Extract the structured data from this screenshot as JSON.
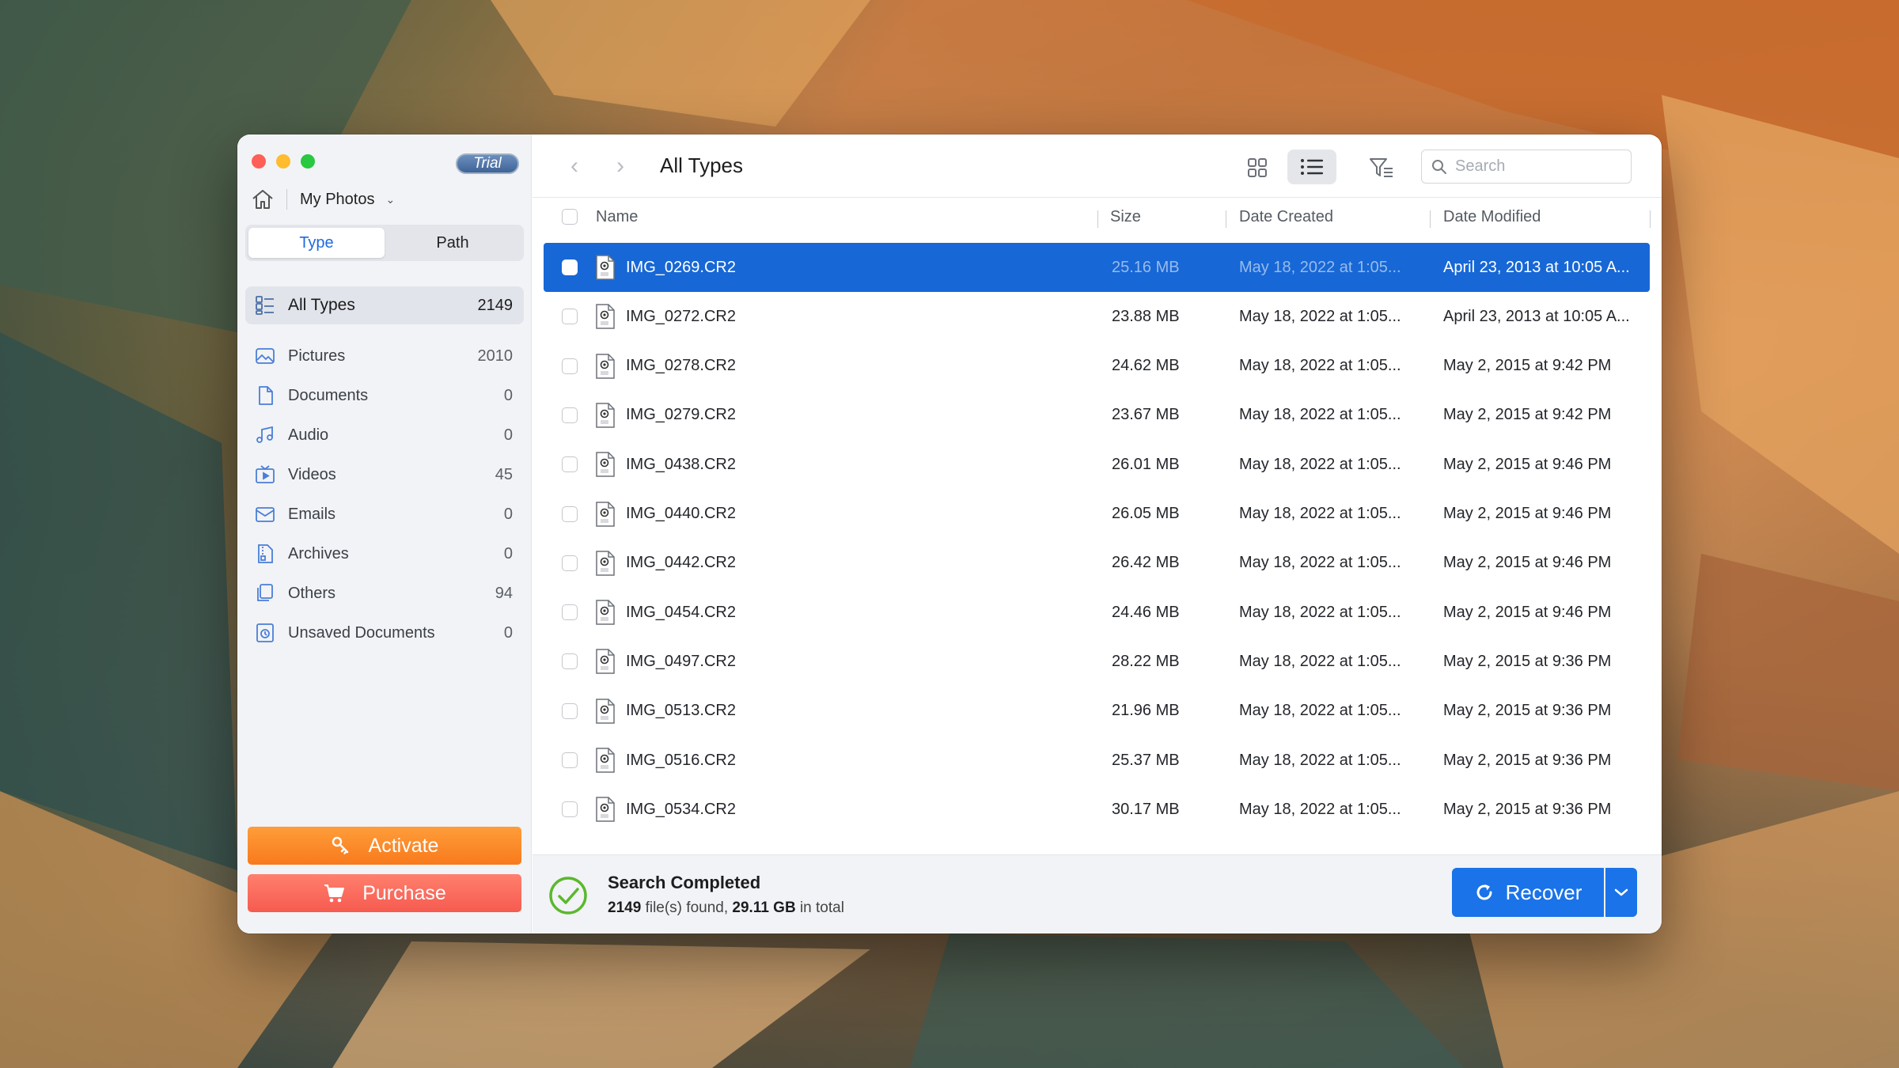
{
  "window": {
    "trial_badge": "Trial",
    "location": "My Photos"
  },
  "sidebar": {
    "segment": {
      "type": "Type",
      "path": "Path",
      "active": "Type"
    },
    "categories": [
      {
        "label": "All Types",
        "count": "2149",
        "icon": "grid-list-icon",
        "active": true
      },
      {
        "label": "Pictures",
        "count": "2010",
        "icon": "picture-icon"
      },
      {
        "label": "Documents",
        "count": "0",
        "icon": "document-icon"
      },
      {
        "label": "Audio",
        "count": "0",
        "icon": "music-note-icon"
      },
      {
        "label": "Videos",
        "count": "45",
        "icon": "video-icon"
      },
      {
        "label": "Emails",
        "count": "0",
        "icon": "mail-icon"
      },
      {
        "label": "Archives",
        "count": "0",
        "icon": "archive-icon"
      },
      {
        "label": "Others",
        "count": "94",
        "icon": "others-icon"
      },
      {
        "label": "Unsaved Documents",
        "count": "0",
        "icon": "unsaved-document-icon"
      }
    ],
    "activate_label": "Activate",
    "purchase_label": "Purchase"
  },
  "toolbar": {
    "title": "All Types",
    "search_placeholder": "Search"
  },
  "table": {
    "columns": {
      "name": "Name",
      "size": "Size",
      "date_created": "Date Created",
      "date_modified": "Date Modified"
    },
    "rows": [
      {
        "name": "IMG_0269.CR2",
        "size": "25.16 MB",
        "created": "May 18, 2022 at 1:05...",
        "modified": "April 23, 2013 at 10:05 A...",
        "selected": true
      },
      {
        "name": "IMG_0272.CR2",
        "size": "23.88 MB",
        "created": "May 18, 2022 at 1:05...",
        "modified": "April 23, 2013 at 10:05 A..."
      },
      {
        "name": "IMG_0278.CR2",
        "size": "24.62 MB",
        "created": "May 18, 2022 at 1:05...",
        "modified": "May 2, 2015 at 9:42 PM"
      },
      {
        "name": "IMG_0279.CR2",
        "size": "23.67 MB",
        "created": "May 18, 2022 at 1:05...",
        "modified": "May 2, 2015 at 9:42 PM"
      },
      {
        "name": "IMG_0438.CR2",
        "size": "26.01 MB",
        "created": "May 18, 2022 at 1:05...",
        "modified": "May 2, 2015 at 9:46 PM"
      },
      {
        "name": "IMG_0440.CR2",
        "size": "26.05 MB",
        "created": "May 18, 2022 at 1:05...",
        "modified": "May 2, 2015 at 9:46 PM"
      },
      {
        "name": "IMG_0442.CR2",
        "size": "26.42 MB",
        "created": "May 18, 2022 at 1:05...",
        "modified": "May 2, 2015 at 9:46 PM"
      },
      {
        "name": "IMG_0454.CR2",
        "size": "24.46 MB",
        "created": "May 18, 2022 at 1:05...",
        "modified": "May 2, 2015 at 9:46 PM"
      },
      {
        "name": "IMG_0497.CR2",
        "size": "28.22 MB",
        "created": "May 18, 2022 at 1:05...",
        "modified": "May 2, 2015 at 9:36 PM"
      },
      {
        "name": "IMG_0513.CR2",
        "size": "21.96 MB",
        "created": "May 18, 2022 at 1:05...",
        "modified": "May 2, 2015 at 9:36 PM"
      },
      {
        "name": "IMG_0516.CR2",
        "size": "25.37 MB",
        "created": "May 18, 2022 at 1:05...",
        "modified": "May 2, 2015 at 9:36 PM"
      },
      {
        "name": "IMG_0534.CR2",
        "size": "30.17 MB",
        "created": "May 18, 2022 at 1:05...",
        "modified": "May 2, 2015 at 9:36 PM"
      }
    ]
  },
  "status": {
    "title": "Search Completed",
    "files_count": "2149",
    "files_suffix": "file(s) found,",
    "total_size": "29.11 GB",
    "total_suffix": "in total"
  },
  "recover_label": "Recover",
  "colors": {
    "accent": "#1a73e8",
    "selection": "#1767d6",
    "activate": "#f87a1c",
    "purchase": "#f65b4f",
    "success": "#5cb82e"
  }
}
